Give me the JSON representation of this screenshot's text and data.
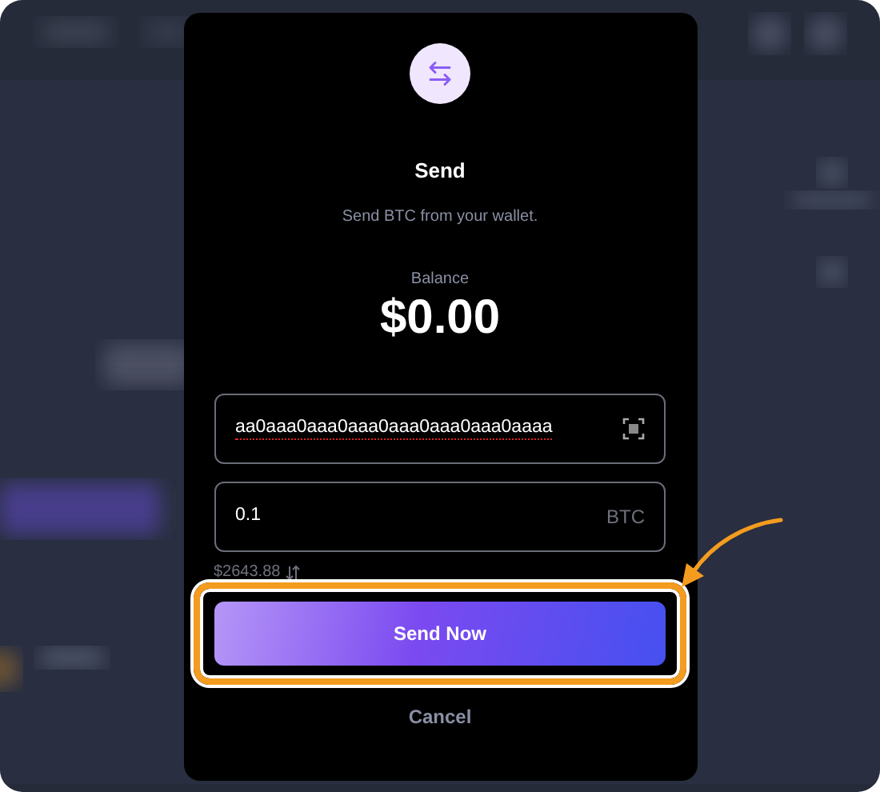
{
  "dialog": {
    "title": "Send",
    "subtitle": "Send BTC from your wallet.",
    "balance": {
      "label": "Balance",
      "value": "$0.00"
    },
    "address_field": {
      "value": "aa0aaa0aaa0aaa0aaa0aaa0aaa0aaaa",
      "spellcheck_error": true
    },
    "amount_field": {
      "value": "0.1",
      "unit": "BTC"
    },
    "converted_amount": "$2643.88",
    "primary_button": {
      "label": "Send Now",
      "highlighted": true
    },
    "cancel_button": {
      "label": "Cancel"
    }
  }
}
